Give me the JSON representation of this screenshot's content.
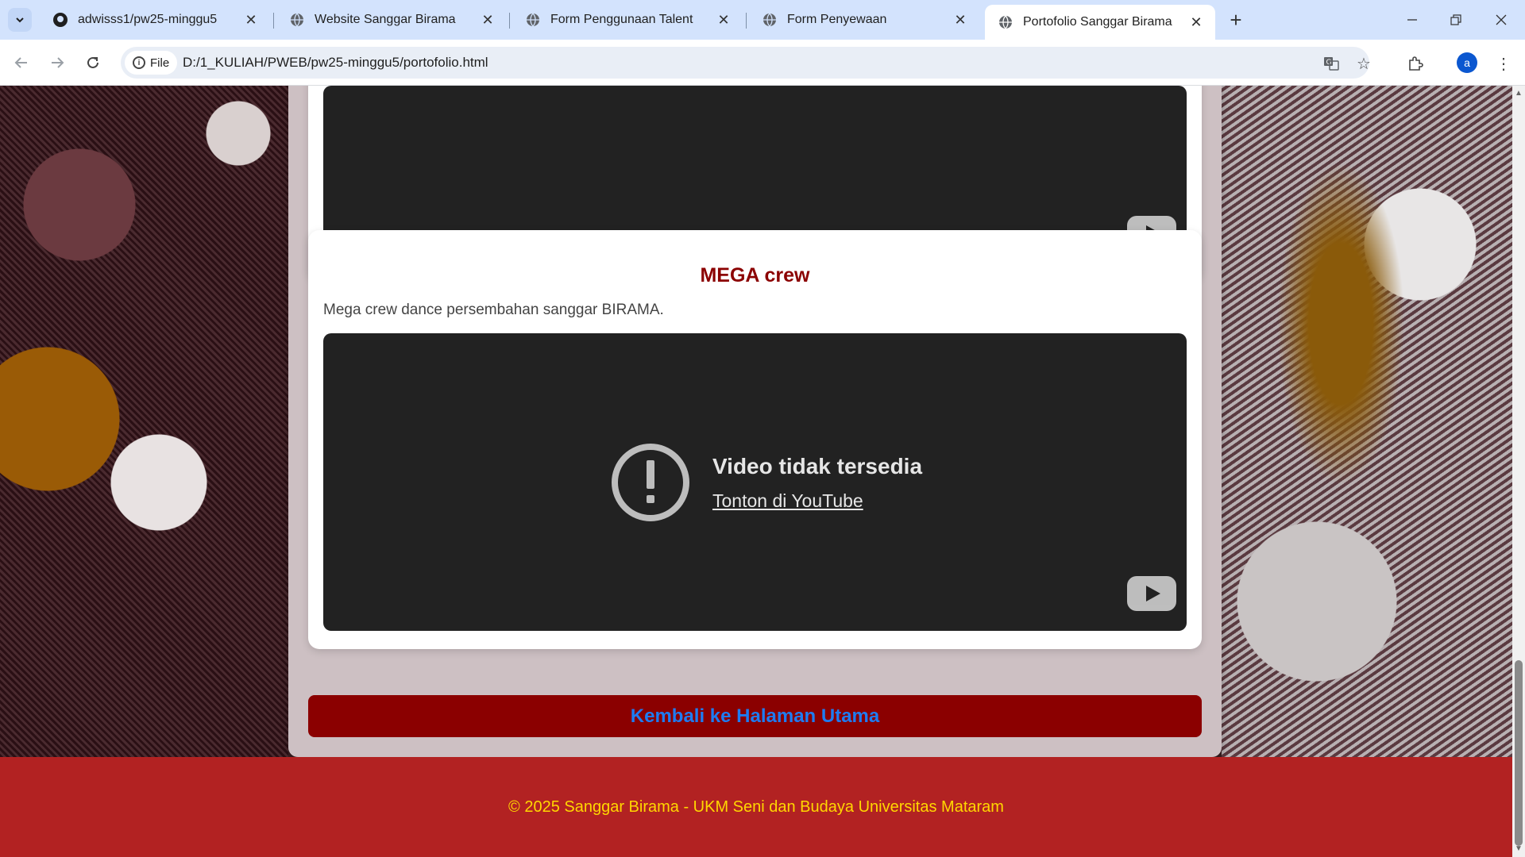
{
  "browser": {
    "tabs": [
      {
        "title": "adwisss1/pw25-minggu5",
        "icon": "github-icon"
      },
      {
        "title": "Website Sanggar Birama",
        "icon": "globe-icon"
      },
      {
        "title": "Form Penggunaan Talent",
        "icon": "globe-icon"
      },
      {
        "title": "Form Penyewaan",
        "icon": "globe-icon"
      },
      {
        "title": "Portofolio Sanggar Birama",
        "icon": "globe-icon",
        "active": true
      }
    ],
    "chip_label": "File",
    "url": "D:/1_KULIAH/PWEB/pw25-minggu5/portofolio.html",
    "avatar_letter": "a"
  },
  "page": {
    "card": {
      "title": "MEGA crew",
      "description": "Mega crew dance persembahan sanggar BIRAMA.",
      "video": {
        "error_title": "Video tidak tersedia",
        "error_link": "Tonton di YouTube"
      }
    },
    "back_button": "Kembali ke Halaman Utama",
    "footer": "© 2025 Sanggar Birama - UKM Seni dan Budaya Universitas Mataram"
  },
  "colors": {
    "title": "#8b0000",
    "button_bg": "#8b0000",
    "button_text": "#1e7cf2",
    "footer_bg": "#b22222",
    "footer_text": "#ffd700"
  }
}
